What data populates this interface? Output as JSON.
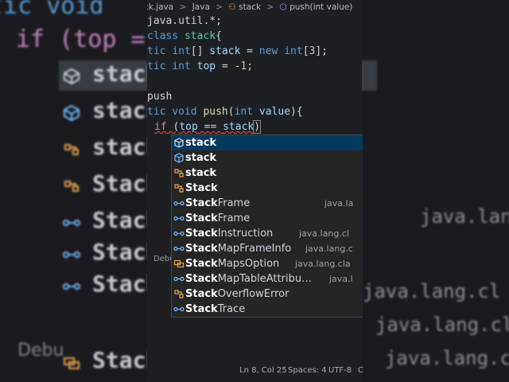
{
  "background": {
    "top_left_text": "tic void",
    "if_line": "if (top =",
    "debug_label": "Debu",
    "rows": [
      {
        "label": "stack",
        "icon": "cube-icon",
        "selected": true
      },
      {
        "label": "stack",
        "icon": "cube-icon"
      },
      {
        "label": "stack",
        "icon": "field-icon"
      },
      {
        "label": "Stack",
        "icon": "field-icon"
      },
      {
        "label": "Stack",
        "icon": "link-icon"
      },
      {
        "label": "Stack",
        "icon": "link-icon"
      },
      {
        "label": "Stack",
        "icon": "link-icon"
      },
      {
        "label": "Stack",
        "icon": "link-icon"
      },
      {
        "label": "Stack",
        "icon": "enum-icon"
      },
      {
        "label": "Stack",
        "icon": "link-icon"
      }
    ],
    "right_packages": [
      "java.lan",
      "java.lang.cl",
      "java.lang.cl",
      "java.lang.cl"
    ]
  },
  "breadcrumb": {
    "file": "ck.java",
    "sep1": ">",
    "lang": "Java",
    "sep2": ">",
    "cls": "stack",
    "sep3": ">",
    "method": "push(int value)"
  },
  "code": {
    "line1": "java.util.*;",
    "line2a": "class ",
    "line2b": "stack",
    "line2c": "{",
    "line3a": "tic ",
    "line3b": "int",
    "line3c": "[] ",
    "line3d": "stack",
    "line3e": " = ",
    "line3f": "new",
    "line3g": " int",
    "line3h": "[",
    "line3i": "3",
    "line3j": "];",
    "line4a": "tic ",
    "line4b": "int",
    "line4c": " ",
    "line4d": "top",
    "line4e": " = -",
    "line4f": "1",
    "line4g": ";",
    "line5": "push",
    "line6a": "tic ",
    "line6b": "void",
    "line6c": " ",
    "line6d": "push",
    "line6e": "(",
    "line6f": "int",
    "line6g": " ",
    "line6h": "value",
    "line6i": "){",
    "line7a": "if",
    "line7b": " (",
    "line7c": "top",
    "line7d": " == ",
    "line7e": "stack",
    "line7f": ")"
  },
  "suggestions": [
    {
      "match": "stack",
      "rest": "",
      "pkg": "",
      "icon": "cube-icon",
      "active": true
    },
    {
      "match": "stack",
      "rest": "",
      "pkg": "",
      "icon": "cube-icon"
    },
    {
      "match": "stack",
      "rest": "",
      "pkg": "",
      "icon": "field-icon"
    },
    {
      "match": "Stack",
      "rest": "",
      "pkg": "",
      "icon": "field-icon"
    },
    {
      "match": "Stack",
      "rest": "Frame",
      "pkg": "java.la",
      "icon": "link-icon"
    },
    {
      "match": "Stack",
      "rest": "Frame",
      "pkg": "",
      "icon": "link-icon"
    },
    {
      "match": "Stack",
      "rest": "Instruction",
      "pkg": "java.lang.cl",
      "icon": "link-icon"
    },
    {
      "match": "Stack",
      "rest": "MapFrameInfo",
      "pkg": "java.lang.c",
      "icon": "link-icon"
    },
    {
      "match": "Stack",
      "rest": "MapsOption",
      "pkg": "java.lang.cla",
      "icon": "enum-icon"
    },
    {
      "match": "Stack",
      "rest": "MapTableAttribu…",
      "pkg": "java.l",
      "icon": "link-icon"
    },
    {
      "match": "Stack",
      "rest": "OverflowError",
      "pkg": "",
      "icon": "field-icon"
    },
    {
      "match": "Stack",
      "rest": "Trace",
      "pkg": "",
      "icon": "link-icon"
    }
  ],
  "debug_tab": "Debu",
  "status": {
    "position": "Ln 8, Col 25",
    "spaces": "Spaces: 4",
    "encoding": "UTF-8",
    "extra": "C"
  },
  "colors": {
    "keyword": "#569cd6",
    "variable": "#9cdcfe",
    "selection": "#04395e"
  }
}
